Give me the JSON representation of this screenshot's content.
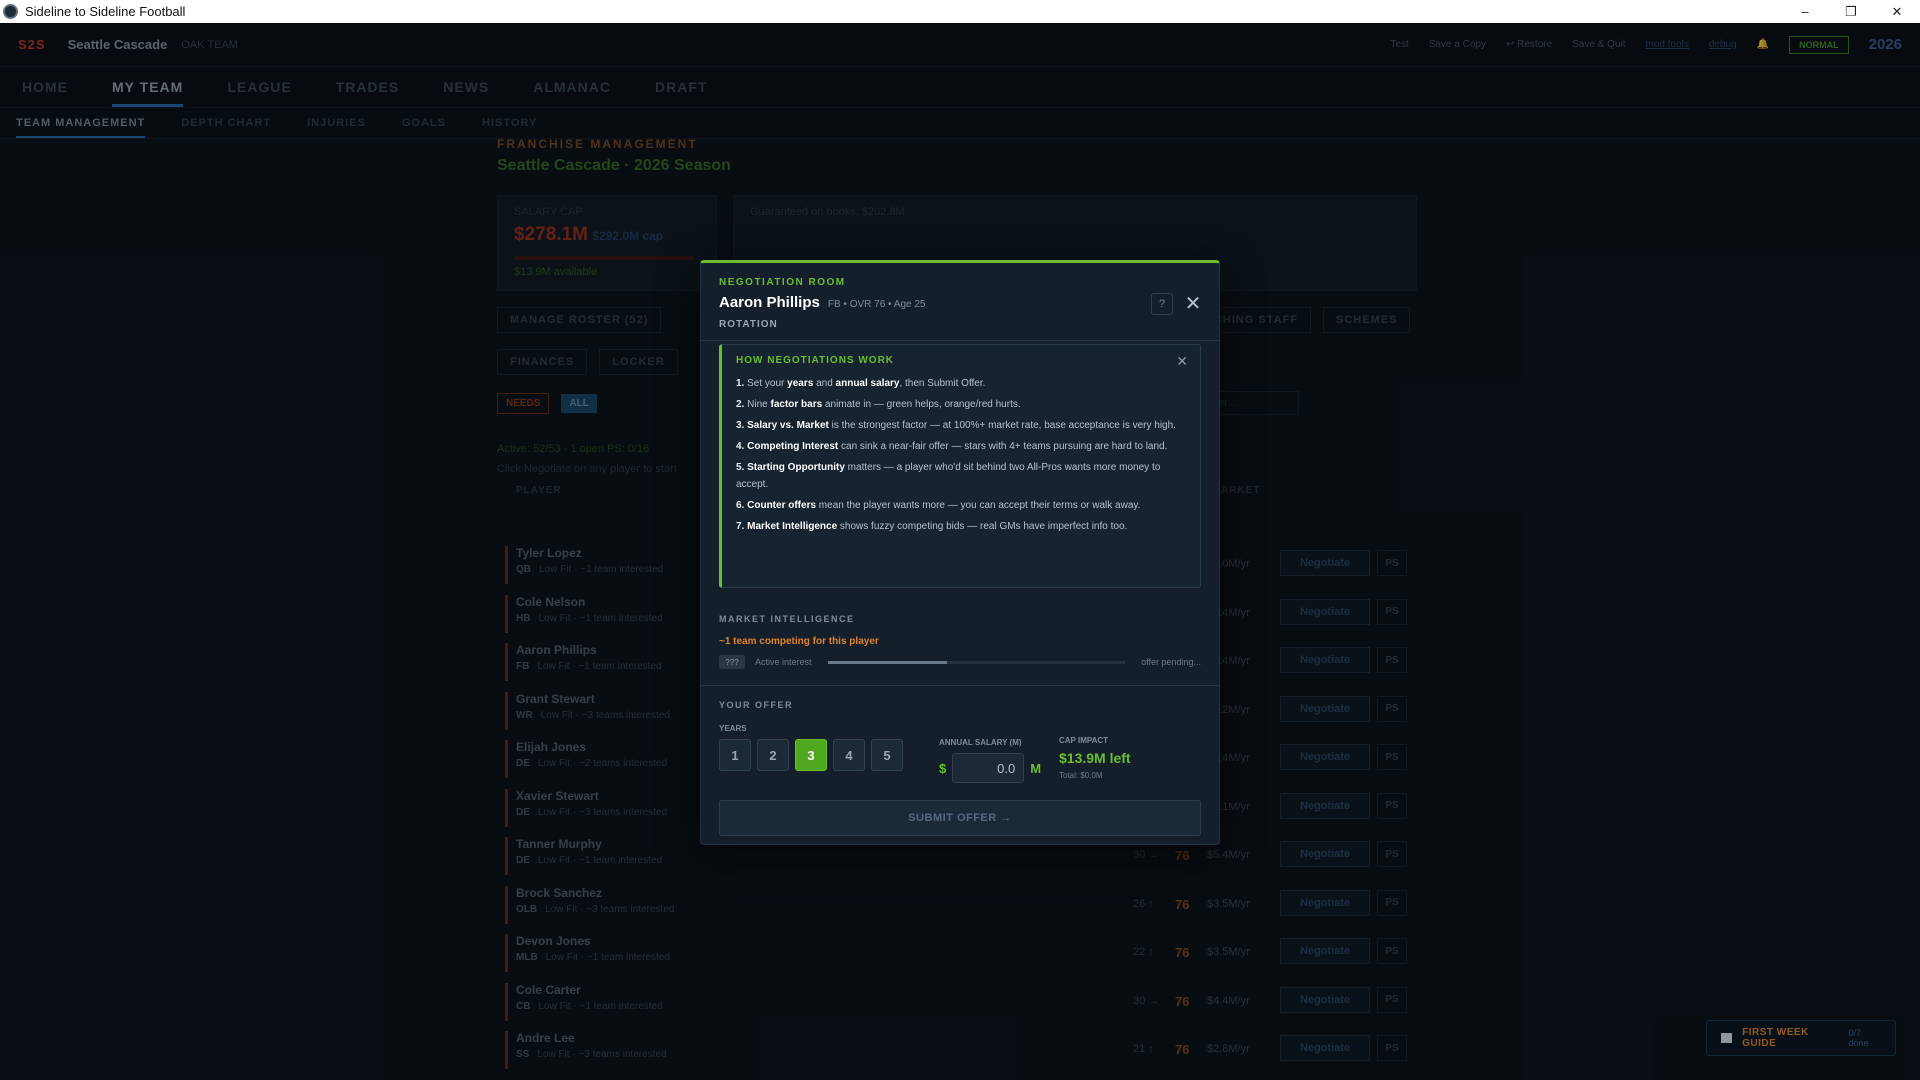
{
  "window": {
    "title": "Sideline to Sideline Football",
    "minimize": "–",
    "restore": "❐",
    "close": "✕"
  },
  "topbar": {
    "logo": "S2S",
    "team": "Seattle Cascade",
    "team_sub": "OAK TEAM",
    "user": "Test",
    "save_copy": "Save a Copy",
    "restore": "↩ Restore",
    "save_quit": "Save & Quit",
    "link1": "mod tools",
    "link2": "debug",
    "difficulty": "NORMAL",
    "year": "2026"
  },
  "nav": {
    "items": [
      "HOME",
      "MY TEAM",
      "LEAGUE",
      "TRADES",
      "NEWS",
      "ALMANAC",
      "DRAFT"
    ],
    "active": "MY TEAM"
  },
  "subnav": {
    "items": [
      "TEAM MANAGEMENT",
      "DEPTH CHART",
      "INJURIES",
      "GOALS",
      "HISTORY"
    ]
  },
  "franchise": {
    "eyebrow": "FRANCHISE MANAGEMENT",
    "season": "Seattle Cascade · 2026 Season",
    "salary_cap_label": "SALARY CAP",
    "cap_value": "$278.1M",
    "cap_used": "$292.0M cap",
    "cap_available": "$13.9M available",
    "guaranteed": "Guaranteed on books: $202.8M"
  },
  "buttons": {
    "manage_roster": "MANAGE ROSTER (52)",
    "coaching_staff": "COACHING STAFF",
    "schemes": "SCHEMES",
    "finances": "FINANCES",
    "locker": "LOCKER"
  },
  "filters": {
    "needs": "NEEDS",
    "all": "ALL",
    "search_placeholder": "Search player..."
  },
  "roster": {
    "status": "Active: 52/53 · 1 open    PS: 0/16",
    "hint": "Click Negotiate on any player to start",
    "col_player": "PLAYER",
    "col_market": "MARKET",
    "negotiate_label": "Negotiate",
    "ps_label": "PS",
    "rows": [
      {
        "name": "Tyler Lopez",
        "pos": "QB",
        "info": "Low Fit · ~1 team interested",
        "age": "",
        "ovr": "",
        "market": "$4.0M/yr"
      },
      {
        "name": "Cole Nelson",
        "pos": "HB",
        "info": "Low Fit · ~1 team interested",
        "age": "",
        "ovr": "",
        "market": "$3.4M/yr"
      },
      {
        "name": "Aaron Phillips",
        "pos": "FB",
        "info": "Low Fit · ~1 team interested",
        "age": "",
        "ovr": "",
        "market": "$3.4M/yr"
      },
      {
        "name": "Grant Stewart",
        "pos": "WR",
        "info": "Low Fit · ~3 teams interested",
        "age": "",
        "ovr": "",
        "market": "$3.2M/yr"
      },
      {
        "name": "Elijah Jones",
        "pos": "DE",
        "info": "Low Fit · ~2 teams interested",
        "age": "",
        "ovr": "",
        "market": "$3.4M/yr"
      },
      {
        "name": "Xavier Stewart",
        "pos": "DE",
        "info": "Low Fit · ~3 teams interested",
        "age": "",
        "ovr": "",
        "market": "$4.1M/yr"
      },
      {
        "name": "Tanner Murphy",
        "pos": "DE",
        "info": "Low Fit · ~1 team interested",
        "age": "30 →",
        "ovr": "76",
        "market": "$5.4M/yr"
      },
      {
        "name": "Brock Sanchez",
        "pos": "OLB",
        "info": "Low Fit · ~3 teams interested",
        "age": "26 ↑",
        "ovr": "76",
        "market": "$3.5M/yr"
      },
      {
        "name": "Devon Jones",
        "pos": "MLB",
        "info": "Low Fit · ~1 team interested",
        "age": "22 ↑",
        "ovr": "76",
        "market": "$3.5M/yr"
      },
      {
        "name": "Cole Carter",
        "pos": "CB",
        "info": "Low Fit · ~1 team interested",
        "age": "30 →",
        "ovr": "76",
        "market": "$4.4M/yr"
      },
      {
        "name": "Andre Lee",
        "pos": "SS",
        "info": "Low Fit · ~3 teams interested",
        "age": "21 ↑",
        "ovr": "76",
        "market": "$2.8M/yr"
      }
    ]
  },
  "guide": {
    "title": "FIRST WEEK GUIDE",
    "count": "0/7 done"
  },
  "modal": {
    "eyebrow": "NEGOTIATION ROOM",
    "player_name": "Aaron Phillips",
    "player_meta": "FB • OVR 76 • Age 25",
    "role": "ROTATION",
    "help": "?",
    "close": "✕",
    "how": {
      "title": "HOW NEGOTIATIONS WORK",
      "close": "✕",
      "steps": [
        {
          "n": "1.",
          "pre": "Set your ",
          "b1": "years",
          "mid": " and ",
          "b2": "annual salary",
          "post": ", then Submit Offer."
        },
        {
          "n": "2.",
          "pre": "Nine ",
          "b1": "factor bars",
          "mid": "",
          "b2": "",
          "post": " animate in — green helps, orange/red hurts."
        },
        {
          "n": "3.",
          "pre": "",
          "b1": "Salary vs. Market",
          "mid": "",
          "b2": "",
          "post": " is the strongest factor — at 100%+ market rate, base acceptance is very high."
        },
        {
          "n": "4.",
          "pre": "",
          "b1": "Competing Interest",
          "mid": "",
          "b2": "",
          "post": " can sink a near-fair offer — stars with 4+ teams pursuing are hard to land."
        },
        {
          "n": "5.",
          "pre": "",
          "b1": "Starting Opportunity",
          "mid": "",
          "b2": "",
          "post": " matters — a player who'd sit behind two All-Pros wants more money to accept."
        },
        {
          "n": "6.",
          "pre": "",
          "b1": "Counter offers",
          "mid": "",
          "b2": "",
          "post": " mean the player wants more — you can accept their terms or walk away."
        },
        {
          "n": "7.",
          "pre": "",
          "b1": "Market Intelligence",
          "mid": "",
          "b2": "",
          "post": " shows fuzzy competing bids — real GMs have imperfect info too."
        }
      ]
    },
    "market": {
      "title": "MARKET INTELLIGENCE",
      "warning": "~1 team competing for this player",
      "badge": "???",
      "label": "Active interest",
      "status": "offer pending...",
      "interest_fraction": 0.4
    },
    "offer": {
      "title": "YOUR OFFER",
      "years_label": "YEARS",
      "years": [
        "1",
        "2",
        "3",
        "4",
        "5"
      ],
      "selected_year": "3",
      "salary_label": "ANNUAL SALARY (M)",
      "currency": "$",
      "salary_value": "0.0",
      "unit": "M",
      "cap_label": "CAP IMPACT",
      "cap_left": "$13.9M left",
      "cap_total": "Total: $0.0M"
    },
    "submit": "SUBMIT OFFER →"
  },
  "colors": {
    "accent": "#6abe2e",
    "warn": "#e0832a",
    "danger": "#c0392b",
    "blue": "#2b6cb0"
  }
}
